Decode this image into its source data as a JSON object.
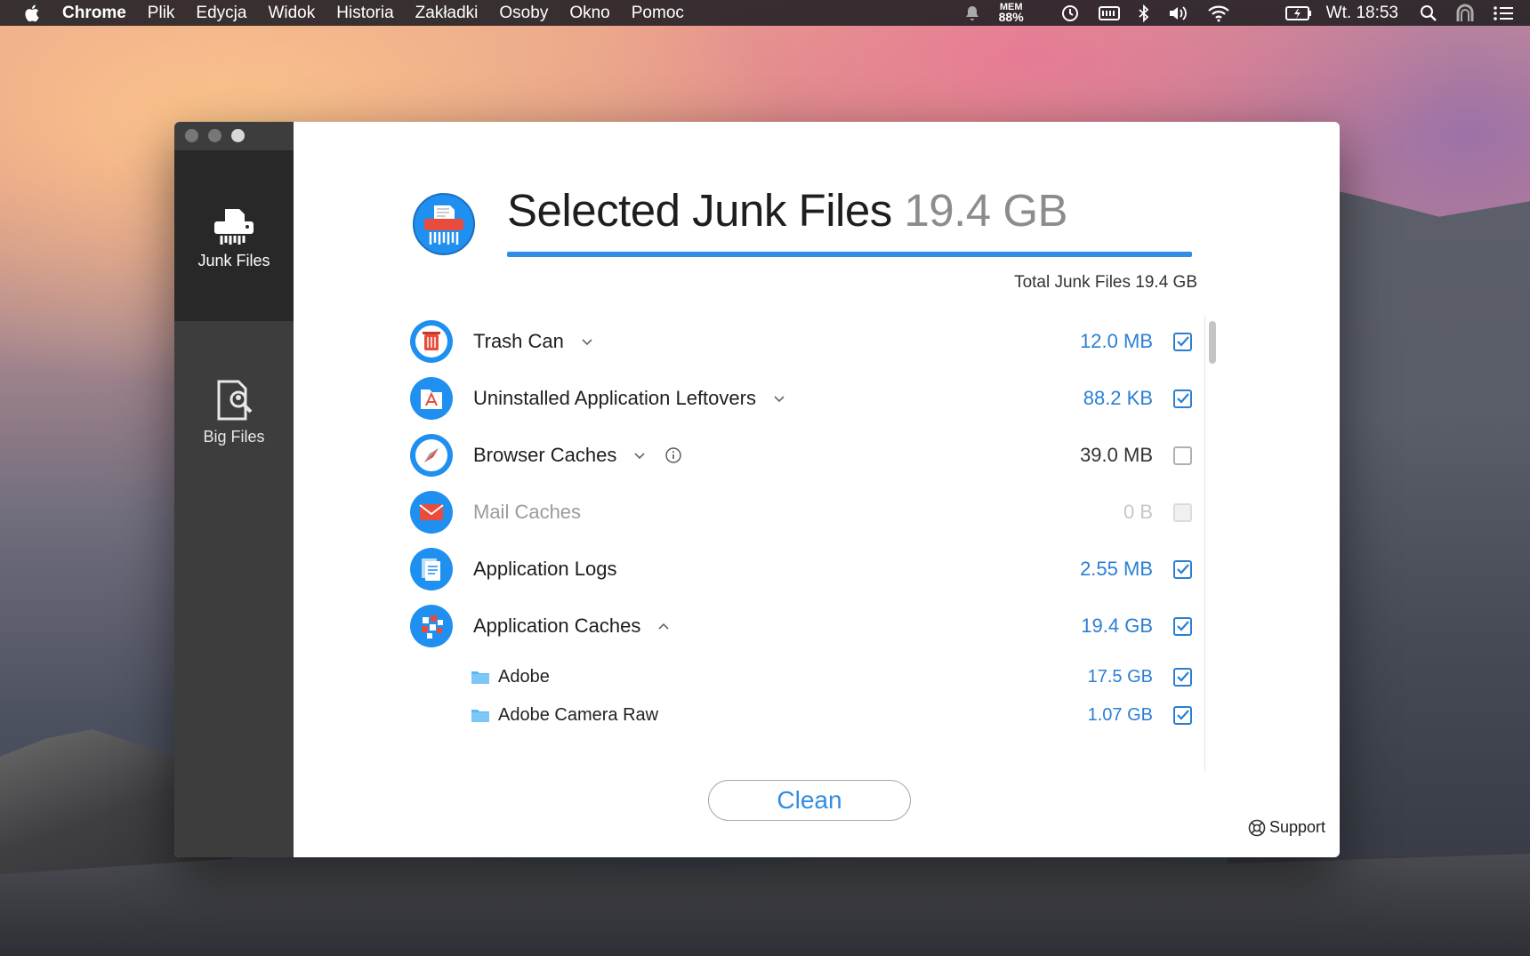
{
  "menubar": {
    "app_name": "Chrome",
    "items": [
      "Plik",
      "Edycja",
      "Widok",
      "Historia",
      "Zakładki",
      "Osoby",
      "Okno",
      "Pomoc"
    ],
    "mem_label": "MEM",
    "mem_value": "88%",
    "clock": "Wt. 18:53"
  },
  "sidebar": {
    "junk_label": "Junk Files",
    "big_label": "Big Files"
  },
  "header": {
    "title": "Selected Junk Files",
    "size": "19.4 GB",
    "total": "Total Junk Files 19.4 GB"
  },
  "rows": [
    {
      "label": "Trash Can",
      "value": "12.0 MB",
      "checked": true
    },
    {
      "label": "Uninstalled Application Leftovers",
      "value": "88.2 KB",
      "checked": true
    },
    {
      "label": "Browser Caches",
      "value": "39.0 MB",
      "checked": false
    },
    {
      "label": "Mail Caches",
      "value": "0 B",
      "checked": false
    },
    {
      "label": "Application Logs",
      "value": "2.55 MB",
      "checked": true
    },
    {
      "label": "Application Caches",
      "value": "19.4 GB",
      "checked": true
    }
  ],
  "subrows": [
    {
      "label": "Adobe",
      "value": "17.5 GB",
      "checked": true
    },
    {
      "label": "Adobe Camera Raw",
      "value": "1.07 GB",
      "checked": true
    }
  ],
  "actions": {
    "clean_label": "Clean",
    "support_label": "Support"
  },
  "colors": {
    "accent": "#2f8de4",
    "sidebar_bg": "#3d3d3d",
    "sidebar_active": "#282828"
  }
}
